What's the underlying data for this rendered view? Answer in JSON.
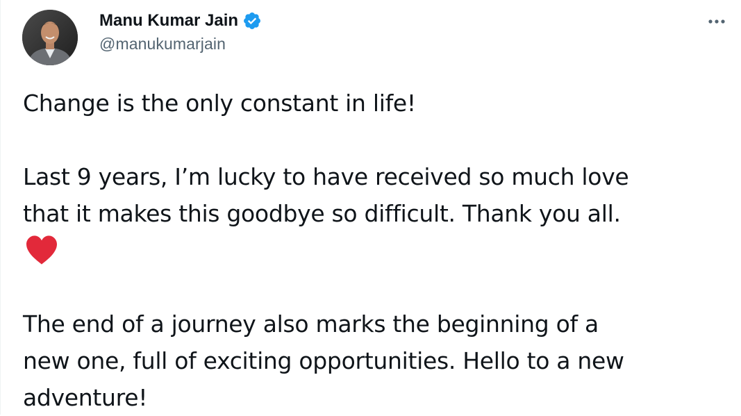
{
  "tweet": {
    "author": {
      "display_name": "Manu Kumar Jain",
      "handle": "@manukumarjain",
      "verified": true,
      "verified_color": "#1d9bf0"
    },
    "more_icon": "more-horizontal-icon",
    "paragraphs": [
      "Change is the only constant in life!",
      "Last 9 years, I’m lucky to have received so much love\nthat it makes this goodbye so difficult. Thank you all.",
      "The end of a journey also marks the beginning of a\nnew one, full of exciting opportunities. Hello to a new\nadventure!"
    ],
    "emoji": "red-heart-emoji",
    "emoji_color": "#e2293a"
  }
}
